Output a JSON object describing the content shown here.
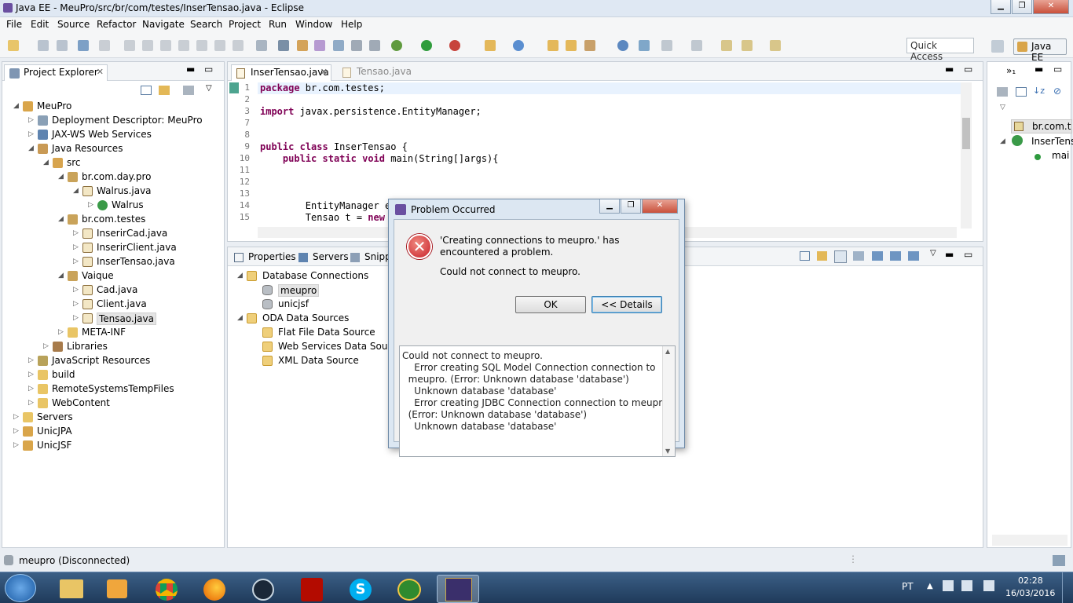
{
  "window": {
    "title": "Java EE - MeuPro/src/br/com/testes/InserTensao.java - Eclipse"
  },
  "menu": [
    "File",
    "Edit",
    "Source",
    "Refactor",
    "Navigate",
    "Search",
    "Project",
    "Run",
    "Window",
    "Help"
  ],
  "quick_access": "Quick Access",
  "perspective": "Java EE",
  "project_explorer": {
    "title": "Project Explorer",
    "items": [
      {
        "label": "MeuPro",
        "level": 0,
        "arrow": "◢",
        "icon": "project-icon"
      },
      {
        "label": "Deployment Descriptor: MeuPro",
        "level": 1,
        "arrow": "▷",
        "icon": "descriptor-icon"
      },
      {
        "label": "JAX-WS Web Services",
        "level": 1,
        "arrow": "▷",
        "icon": "webservice-icon"
      },
      {
        "label": "Java Resources",
        "level": 1,
        "arrow": "◢",
        "icon": "java-resources-icon"
      },
      {
        "label": "src",
        "level": 2,
        "arrow": "◢",
        "icon": "source-folder-icon"
      },
      {
        "label": "br.com.day.pro",
        "level": 3,
        "arrow": "◢",
        "icon": "package-icon"
      },
      {
        "label": "Walrus.java",
        "level": 4,
        "arrow": "◢",
        "icon": "java-file-icon"
      },
      {
        "label": "Walrus",
        "level": 5,
        "arrow": "▷",
        "icon": "class-icon"
      },
      {
        "label": "br.com.testes",
        "level": 3,
        "arrow": "◢",
        "icon": "package-icon"
      },
      {
        "label": "InserirCad.java",
        "level": 4,
        "arrow": "▷",
        "icon": "java-file-icon"
      },
      {
        "label": "InserirClient.java",
        "level": 4,
        "arrow": "▷",
        "icon": "java-file-icon"
      },
      {
        "label": "InserTensao.java",
        "level": 4,
        "arrow": "▷",
        "icon": "java-file-icon"
      },
      {
        "label": "Vaique",
        "level": 3,
        "arrow": "◢",
        "icon": "package-icon"
      },
      {
        "label": "Cad.java",
        "level": 4,
        "arrow": "▷",
        "icon": "java-file-icon"
      },
      {
        "label": "Client.java",
        "level": 4,
        "arrow": "▷",
        "icon": "java-file-icon"
      },
      {
        "label": "Tensao.java",
        "level": 4,
        "arrow": "▷",
        "icon": "java-file-icon"
      },
      {
        "label": "META-INF",
        "level": 3,
        "arrow": "▷",
        "icon": "folder-icon"
      },
      {
        "label": "Libraries",
        "level": 2,
        "arrow": "▷",
        "icon": "library-icon"
      },
      {
        "label": "JavaScript Resources",
        "level": 1,
        "arrow": "▷",
        "icon": "js-resources-icon"
      },
      {
        "label": "build",
        "level": 1,
        "arrow": "▷",
        "icon": "folder-icon"
      },
      {
        "label": "RemoteSystemsTempFiles",
        "level": 1,
        "arrow": "▷",
        "icon": "folder-icon"
      },
      {
        "label": "WebContent",
        "level": 1,
        "arrow": "▷",
        "icon": "folder-icon"
      },
      {
        "label": "Servers",
        "level": 0,
        "arrow": "▷",
        "icon": "folder-icon"
      },
      {
        "label": "UnicJPA",
        "level": 0,
        "arrow": "▷",
        "icon": "project-icon"
      },
      {
        "label": "UnicJSF",
        "level": 0,
        "arrow": "▷",
        "icon": "project-icon"
      }
    ]
  },
  "editor": {
    "tabs": [
      "InserTensao.java",
      "Tensao.java"
    ],
    "lines": [
      {
        "n": "1",
        "text": "package br.com.testes;"
      },
      {
        "n": "2",
        "text": ""
      },
      {
        "n": "3",
        "text": "import javax.persistence.EntityManager;"
      },
      {
        "n": "7",
        "text": ""
      },
      {
        "n": "8",
        "text": ""
      },
      {
        "n": "9",
        "text": "public class InserTensao {"
      },
      {
        "n": "10",
        "text": "    public static void main(String[]args){"
      },
      {
        "n": "11",
        "text": ""
      },
      {
        "n": "12",
        "text": ""
      },
      {
        "n": "13",
        "text": ""
      },
      {
        "n": "14",
        "text": "        EntityManager e"
      },
      {
        "n": "15",
        "text": "        Tensao t = new"
      }
    ]
  },
  "bottom_panel": {
    "tabs": [
      "Properties",
      "Servers",
      "Snipp"
    ],
    "tree": [
      {
        "label": "Database Connections",
        "level": 0,
        "arrow": "◢",
        "icon": "folder-icon"
      },
      {
        "label": "meupro",
        "level": 1,
        "arrow": "",
        "icon": "database-icon"
      },
      {
        "label": "unicjsf",
        "level": 1,
        "arrow": "",
        "icon": "database-icon"
      },
      {
        "label": "ODA Data Sources",
        "level": 0,
        "arrow": "◢",
        "icon": "folder-icon"
      },
      {
        "label": "Flat File Data Source",
        "level": 1,
        "arrow": "",
        "icon": "folder-icon"
      },
      {
        "label": "Web Services Data Source",
        "level": 1,
        "arrow": "",
        "icon": "folder-icon"
      },
      {
        "label": "XML Data Source",
        "level": 1,
        "arrow": "",
        "icon": "folder-icon"
      }
    ]
  },
  "outline": {
    "items": [
      "br.com.t",
      "InserTens",
      "mai"
    ]
  },
  "dialog": {
    "title": "Problem Occurred",
    "message": "'Creating connections to meupro.' has encountered a problem.",
    "submessage": "Could not connect to meupro.",
    "ok": "OK",
    "details_button": "<< Details",
    "details": [
      "Could not connect to meupro.",
      "    Error creating SQL Model Connection connection to",
      "  meupro. (Error: Unknown database 'database')",
      "    Unknown database 'database'",
      "    Error creating JDBC Connection connection to meupro.",
      "  (Error: Unknown database 'database')",
      "    Unknown database 'database'"
    ]
  },
  "status": {
    "text": "meupro (Disconnected)"
  },
  "taskbar": {
    "lang": "PT",
    "time": "02:28",
    "date": "16/03/2016"
  }
}
